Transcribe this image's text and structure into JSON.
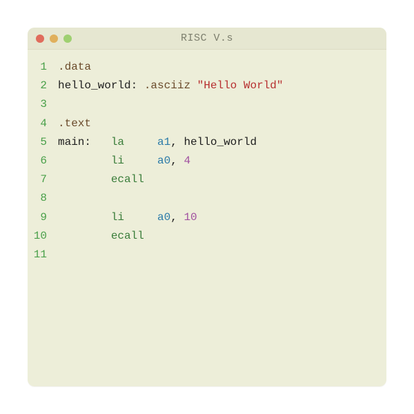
{
  "window": {
    "title": "RISC V.s"
  },
  "colors": {
    "red": "#e06c5c",
    "yellow": "#e0b05c",
    "green": "#9fd071"
  },
  "code": {
    "lines": [
      {
        "n": "1",
        "tokens": [
          {
            "t": ".data",
            "c": "directive"
          }
        ]
      },
      {
        "n": "2",
        "tokens": [
          {
            "t": "hello_world:",
            "c": "label"
          },
          {
            "t": " ",
            "c": "plain"
          },
          {
            "t": ".asciiz",
            "c": "directive"
          },
          {
            "t": " ",
            "c": "plain"
          },
          {
            "t": "\"Hello World\"",
            "c": "str"
          }
        ]
      },
      {
        "n": "3",
        "tokens": []
      },
      {
        "n": "4",
        "tokens": [
          {
            "t": ".text",
            "c": "directive"
          }
        ]
      },
      {
        "n": "5",
        "tokens": [
          {
            "t": "main:",
            "c": "label"
          },
          {
            "t": "   ",
            "c": "plain"
          },
          {
            "t": "la",
            "c": "instr"
          },
          {
            "t": "     ",
            "c": "plain"
          },
          {
            "t": "a1",
            "c": "reg"
          },
          {
            "t": ", ",
            "c": "comma"
          },
          {
            "t": "hello_world",
            "c": "plain"
          }
        ]
      },
      {
        "n": "6",
        "tokens": [
          {
            "t": "        ",
            "c": "plain"
          },
          {
            "t": "li",
            "c": "instr"
          },
          {
            "t": "     ",
            "c": "plain"
          },
          {
            "t": "a0",
            "c": "reg"
          },
          {
            "t": ", ",
            "c": "comma"
          },
          {
            "t": "4",
            "c": "num"
          }
        ]
      },
      {
        "n": "7",
        "tokens": [
          {
            "t": "        ",
            "c": "plain"
          },
          {
            "t": "ecall",
            "c": "instr"
          }
        ]
      },
      {
        "n": "8",
        "tokens": []
      },
      {
        "n": "9",
        "tokens": [
          {
            "t": "        ",
            "c": "plain"
          },
          {
            "t": "li",
            "c": "instr"
          },
          {
            "t": "     ",
            "c": "plain"
          },
          {
            "t": "a0",
            "c": "reg"
          },
          {
            "t": ", ",
            "c": "comma"
          },
          {
            "t": "10",
            "c": "num"
          }
        ]
      },
      {
        "n": "10",
        "tokens": [
          {
            "t": "        ",
            "c": "plain"
          },
          {
            "t": "ecall",
            "c": "instr"
          }
        ]
      },
      {
        "n": "11",
        "tokens": []
      }
    ]
  }
}
